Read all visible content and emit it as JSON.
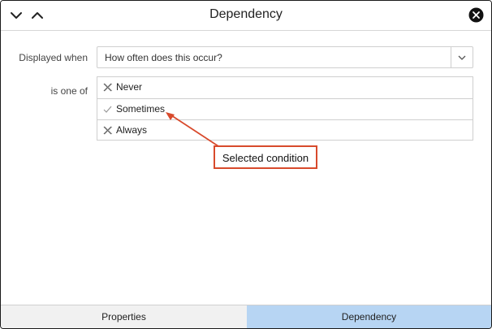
{
  "window": {
    "title": "Dependency"
  },
  "form": {
    "displayed_when_label": "Displayed when",
    "question_value": "How often does this occur?",
    "is_one_of_label": "is one of",
    "options": [
      {
        "label": "Never",
        "state": "excluded",
        "icon": "x-icon"
      },
      {
        "label": "Sometimes",
        "state": "selected",
        "icon": "check-icon"
      },
      {
        "label": "Always",
        "state": "excluded",
        "icon": "x-icon"
      }
    ]
  },
  "annotation": {
    "callout_text": "Selected condition",
    "color": "#d84a2c"
  },
  "tabs": [
    {
      "label": "Properties",
      "active": false
    },
    {
      "label": "Dependency",
      "active": true
    }
  ],
  "colors": {
    "active_tab": "#b7d5f3",
    "inactive_tab": "#f1f1f1"
  }
}
